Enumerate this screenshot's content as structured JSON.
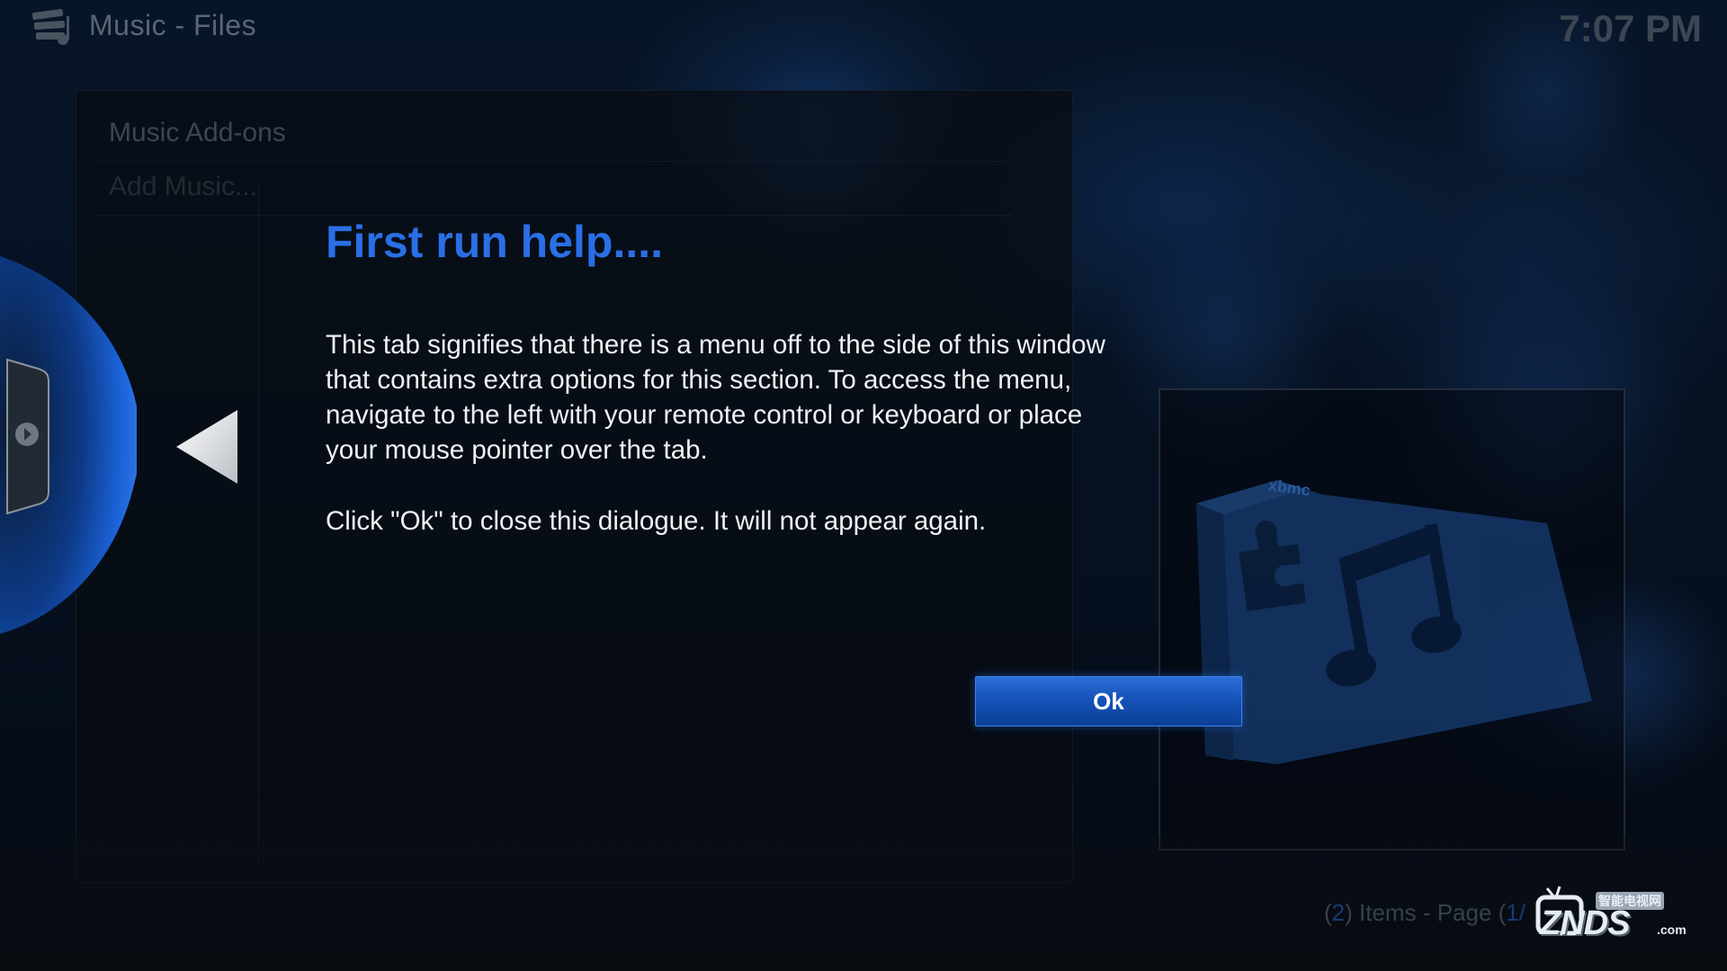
{
  "header": {
    "title": "Music - Files",
    "clock": "7:07 PM",
    "icon": "music-library-icon"
  },
  "list": {
    "items": [
      {
        "label": "Music Add-ons"
      },
      {
        "label": "Add Music..."
      }
    ]
  },
  "dialog": {
    "title": "First run help....",
    "paragraph_1": "This tab signifies that there is a menu off to the side of this window\nthat contains extra options for this section.  To access the menu,\nnavigate to the left with your remote control or keyboard or place\nyour mouse pointer over the tab.",
    "paragraph_2": "Click \"Ok\" to close this dialogue. It will not appear again.",
    "ok_label": "Ok",
    "arrow_icon": "left-arrow-icon",
    "tab_icon": "side-menu-tab-icon"
  },
  "status": {
    "count": "2",
    "items_page_label": ") Items - Page (",
    "page_partial": "1/",
    "open_paren": "("
  },
  "thumbnail": {
    "icon": "music-addons-folder-icon",
    "badge_text": "xbmc"
  },
  "watermark": {
    "brand": "ZNDS",
    "domain_suffix": ".com",
    "tagline": "智能电视网"
  },
  "colors": {
    "accent": "#2a6fe6",
    "button": "#1553b8",
    "text": "#eef1f4",
    "background": "#06101f"
  }
}
